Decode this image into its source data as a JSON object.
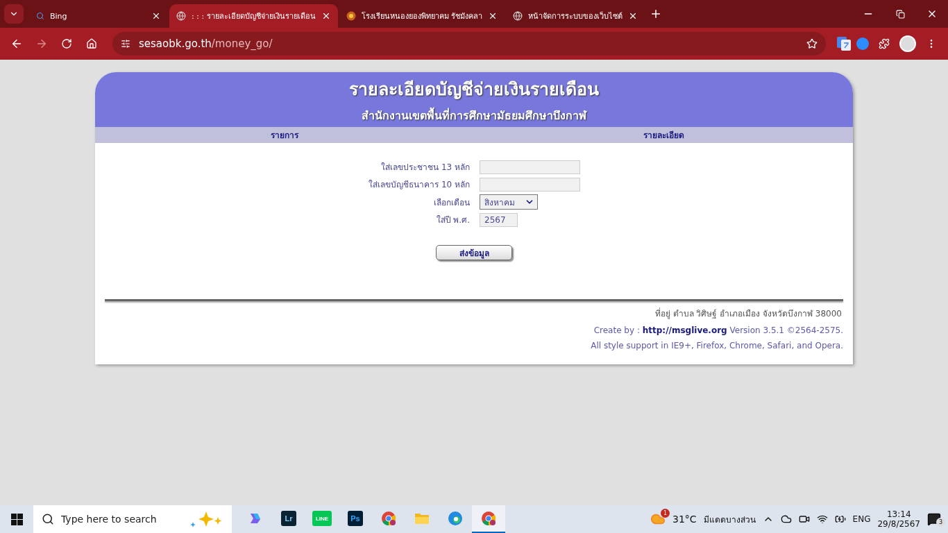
{
  "browser": {
    "tabs": [
      {
        "title": "Bing",
        "selected": false
      },
      {
        "title": ": : : รายละเอียดบัญชีจ่ายเงินรายเดือน",
        "selected": true
      },
      {
        "title": "โรงเรียนหนองยองพิทยาคม รัชมังคลา",
        "selected": false
      },
      {
        "title": "หน้าจัดการระบบของเว็บไซต์",
        "selected": false
      }
    ],
    "address": {
      "host": "sesaobk.go.th",
      "path": "/money_go/"
    }
  },
  "page": {
    "title": "รายละเอียดบัญชีจ่ายเงินรายเดือน",
    "subtitle": "สำนักงานเขตพื้นที่การศึกษามัธยมศึกษาบึงกาฬ",
    "columns": [
      "รายการ",
      "รายละเอียด"
    ],
    "form": [
      {
        "kind": "text",
        "label": "ใส่เลขประชาชน 13 หลัก"
      },
      {
        "kind": "text",
        "label": "ใส่เลขบัญชีธนาคาร 10 หลัก"
      },
      {
        "kind": "select",
        "label": "เลือกเดือน",
        "value": "สิงหาคม"
      },
      {
        "kind": "short",
        "label": "ใส่ปี พ.ศ.",
        "value": "2567"
      }
    ],
    "submit": "ส่งข้อมูล",
    "footer": {
      "address": "ที่อยู่ ตำบล วิศิษฐ์ อำเภอเมือง จังหวัดบึงกาฬ 38000",
      "credit_prefix": "Create by :",
      "credit_link": "http://msglive.org",
      "credit_suffix": "Version 3.5.1 ©2564-2575.",
      "support": "All style support in IE9+, Firefox, Chrome, Safari, and Opera."
    }
  },
  "taskbar": {
    "search_placeholder": "Type here to search",
    "apps": [
      {
        "kind": "copilot",
        "selected": false
      },
      {
        "kind": "tile",
        "label": "Lr",
        "selected": false
      },
      {
        "kind": "line",
        "label": "LINE",
        "selected": false
      },
      {
        "kind": "tile",
        "label": "Ps",
        "selected": false
      },
      {
        "kind": "chrome",
        "selected": false
      },
      {
        "kind": "folder",
        "selected": false
      },
      {
        "kind": "edge",
        "selected": false
      },
      {
        "kind": "chrome",
        "selected": true
      }
    ],
    "weather": {
      "badge": "1",
      "temperature": "31°C",
      "condition": "มีแดดบางส่วน"
    },
    "language": "ENG",
    "time": "13:14",
    "date": "29/8/2567",
    "notifications": "3"
  }
}
